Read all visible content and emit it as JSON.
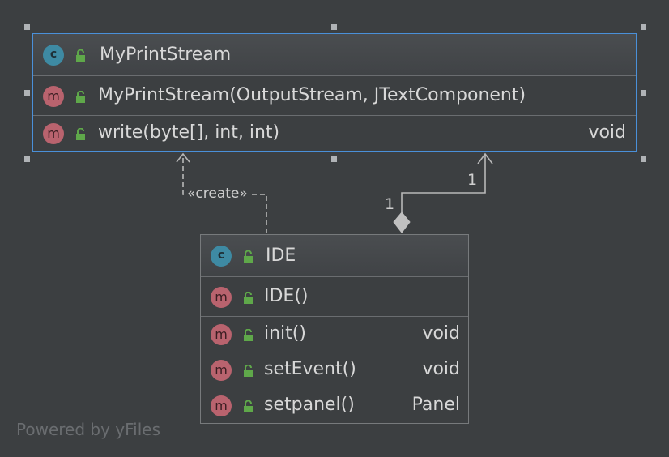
{
  "classes": {
    "mps": {
      "kind_badge": "c",
      "name": "MyPrintStream",
      "constructors": [
        {
          "badge": "m",
          "signature": "MyPrintStream(OutputStream, JTextComponent)",
          "return": ""
        }
      ],
      "methods": [
        {
          "badge": "m",
          "signature": "write(byte[], int, int)",
          "return": "void"
        }
      ]
    },
    "ide": {
      "kind_badge": "c",
      "name": "IDE",
      "constructors": [
        {
          "badge": "m",
          "signature": "IDE()",
          "return": ""
        }
      ],
      "methods": [
        {
          "badge": "m",
          "signature": "init()",
          "return": "void"
        },
        {
          "badge": "m",
          "signature": "setEvent()",
          "return": "void"
        },
        {
          "badge": "m",
          "signature": "setpanel()",
          "return": "Panel"
        }
      ]
    }
  },
  "edges": {
    "create_stereotype": "«create»",
    "composition_source_mult": "1",
    "composition_target_mult": "1"
  },
  "footer": "Powered by yFiles",
  "colors": {
    "background": "#3c3f41",
    "selection": "#4a90d9",
    "class_badge": "#3e8aa3",
    "method_badge": "#b9636e",
    "lock_icon": "#5fa84a"
  }
}
